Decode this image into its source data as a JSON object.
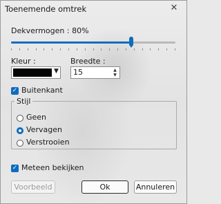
{
  "window": {
    "title": "Toenemende omtrek",
    "close_glyph": "✕",
    "background_image": "person-photo-blurred"
  },
  "opacity": {
    "label": "Dekvermogen : 80%",
    "value_percent": 80
  },
  "color": {
    "label": "Kleur :",
    "swatch": "#050505",
    "icon": "chevron-down-icon",
    "arrow_glyph": "▼"
  },
  "width": {
    "label": "Breedte :",
    "value": "15",
    "up_glyph": "▲",
    "down_glyph": "▼"
  },
  "outside": {
    "label": "Buitenkant",
    "checked": true,
    "check_glyph": "✓"
  },
  "style_group": {
    "label": "Stijl",
    "options": [
      {
        "label": "Geen",
        "selected": false
      },
      {
        "label": "Vervagen",
        "selected": true
      },
      {
        "label": "Verstrooien",
        "selected": false
      }
    ]
  },
  "preview": {
    "label": "Meteen bekijken",
    "checked": true
  },
  "buttons": {
    "preview": "Voorbeeld",
    "ok": "Ok",
    "cancel": "Annuleren"
  },
  "colors": {
    "accent": "#0f6cbd",
    "disabled_text": "#9b9b9b"
  }
}
